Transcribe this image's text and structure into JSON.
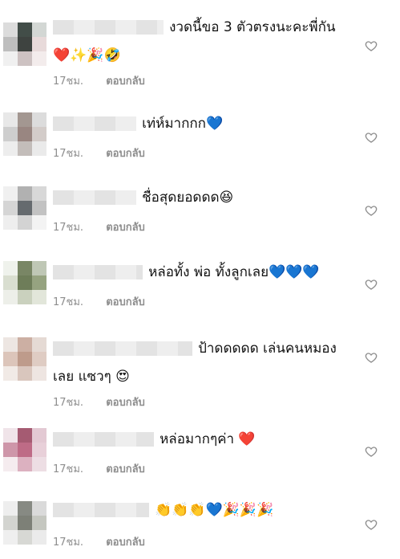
{
  "comments": [
    {
      "avatar_colors": [
        "#d9d9d9",
        "#2e3a35",
        "#cfd3d0",
        "#b8b8b8",
        "#2a2f2c",
        "#e6d7d7",
        "#efefef",
        "#c8bcbc",
        "#f2eaea"
      ],
      "text": "งวดนี้ขอ 3 ตัวตรงนะคะพี่กัน",
      "text2": "❤️✨🎉🤣",
      "time": "17ชม.",
      "reply": "ตอบกลับ"
    },
    {
      "avatar_colors": [
        "#e6e6e6",
        "#9a8c86",
        "#d9d9d9",
        "#c9c9c9",
        "#8e7a74",
        "#cfc7c4",
        "#ececec",
        "#bdb6b3",
        "#e8e8e8"
      ],
      "text": "เท่ห์มากกก💙",
      "time": "17ชม.",
      "reply": "ตอบกลับ"
    },
    {
      "avatar_colors": [
        "#efefef",
        "#a9a9a9",
        "#d4d4d4",
        "#d1d1d1",
        "#555a5f",
        "#bcbcbc",
        "#ededed",
        "#cfcfcf",
        "#f2f2f2"
      ],
      "text": "ชื่อสุดยอดดด😆",
      "time": "17ชม.",
      "reply": "ตอบกลับ"
    },
    {
      "avatar_colors": [
        "#eef1ea",
        "#6b7a55",
        "#b9c1ad",
        "#d5dbcb",
        "#5f7048",
        "#8b9a73",
        "#eceee7",
        "#c5cdb7",
        "#dfe4d6"
      ],
      "text": "หล่อทั้ง พ่อ ทั้งลูกเลย💙💙💙",
      "time": "17ชม.",
      "reply": "ตอบกลับ"
    },
    {
      "avatar_colors": [
        "#ece4df",
        "#c7a79a",
        "#e3d6d0",
        "#d9bfb3",
        "#b8917f",
        "#dcc7bd",
        "#f0e8e4",
        "#d5c0b6",
        "#ede3de"
      ],
      "text": "ป้าดดดดด เล่นคนหมอง",
      "text2": "เลย แซวๆ 😍",
      "time": "17ชม.",
      "reply": "ตอบกลับ"
    },
    {
      "avatar_colors": [
        "#efe2e7",
        "#9c4a63",
        "#e1c4cf",
        "#c98ba0",
        "#b85c79",
        "#e6cbd5",
        "#f4eaee",
        "#d9a9ba",
        "#ecdbe2"
      ],
      "text": "หล่อมากๆค่า ❤️",
      "time": "17ชม.",
      "reply": "ตอบกลับ"
    },
    {
      "avatar_colors": [
        "#ededed",
        "#7b7e76",
        "#d6d6d6",
        "#cfd0cc",
        "#6f7369",
        "#bfc1ba",
        "#eeeeee",
        "#d3d4d0",
        "#e9e9e9"
      ],
      "text": "👏👏👏💙🎉🎉🎉",
      "time": "17ชม.",
      "reply": "ตอบกลับ"
    }
  ]
}
